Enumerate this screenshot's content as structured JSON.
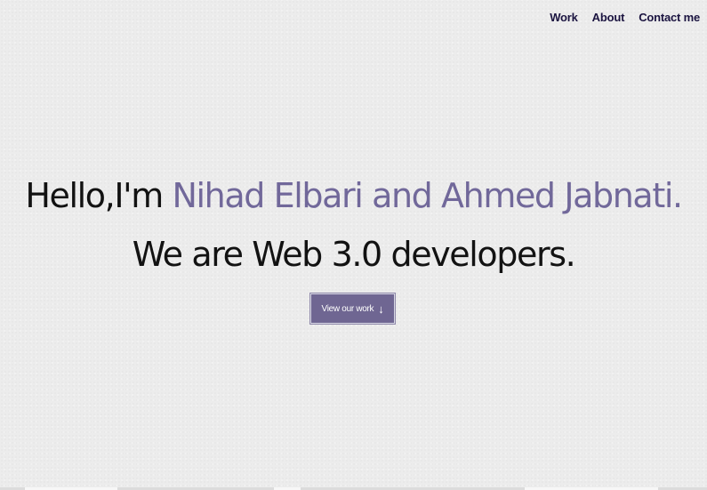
{
  "nav": {
    "items": [
      {
        "label": "Work"
      },
      {
        "label": "About"
      },
      {
        "label": "Contact me"
      }
    ]
  },
  "hero": {
    "greeting": "Hello,I'm ",
    "names": "Nihad Elbari and Ahmed Jabnati.",
    "tagline": "We are Web 3.0 developers."
  },
  "cta": {
    "label": "View our work",
    "icon": "arrow-down-icon",
    "arrow": "↓"
  },
  "colors": {
    "accent": "#71689a",
    "button": "#6f6692",
    "nav_text": "#1b1440",
    "background": "#ececec"
  }
}
